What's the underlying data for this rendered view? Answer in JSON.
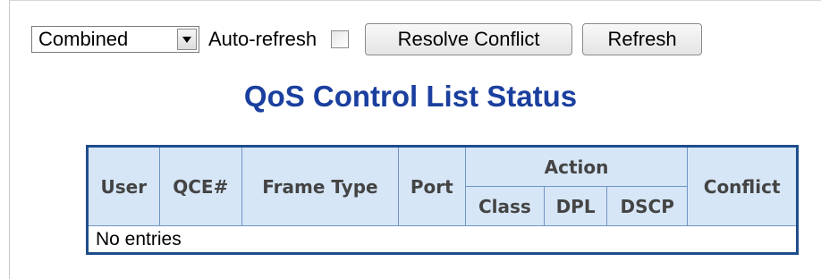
{
  "toolbar": {
    "view_select": {
      "value": "Combined"
    },
    "auto_refresh_label": "Auto-refresh",
    "auto_refresh_checked": false,
    "resolve_button": "Resolve Conflict",
    "refresh_button": "Refresh"
  },
  "title": "QoS Control List Status",
  "table": {
    "columns": {
      "user": "User",
      "qce": "QCE#",
      "frame_type": "Frame Type",
      "port": "Port",
      "action": "Action",
      "conflict": "Conflict",
      "class": "Class",
      "dpl": "DPL",
      "dscp": "DSCP"
    },
    "rows": [],
    "empty_message": "No entries"
  },
  "colors": {
    "title": "#1a3f9e",
    "table_border": "#1e4d8c",
    "header_bg": "#d6e6f7"
  }
}
